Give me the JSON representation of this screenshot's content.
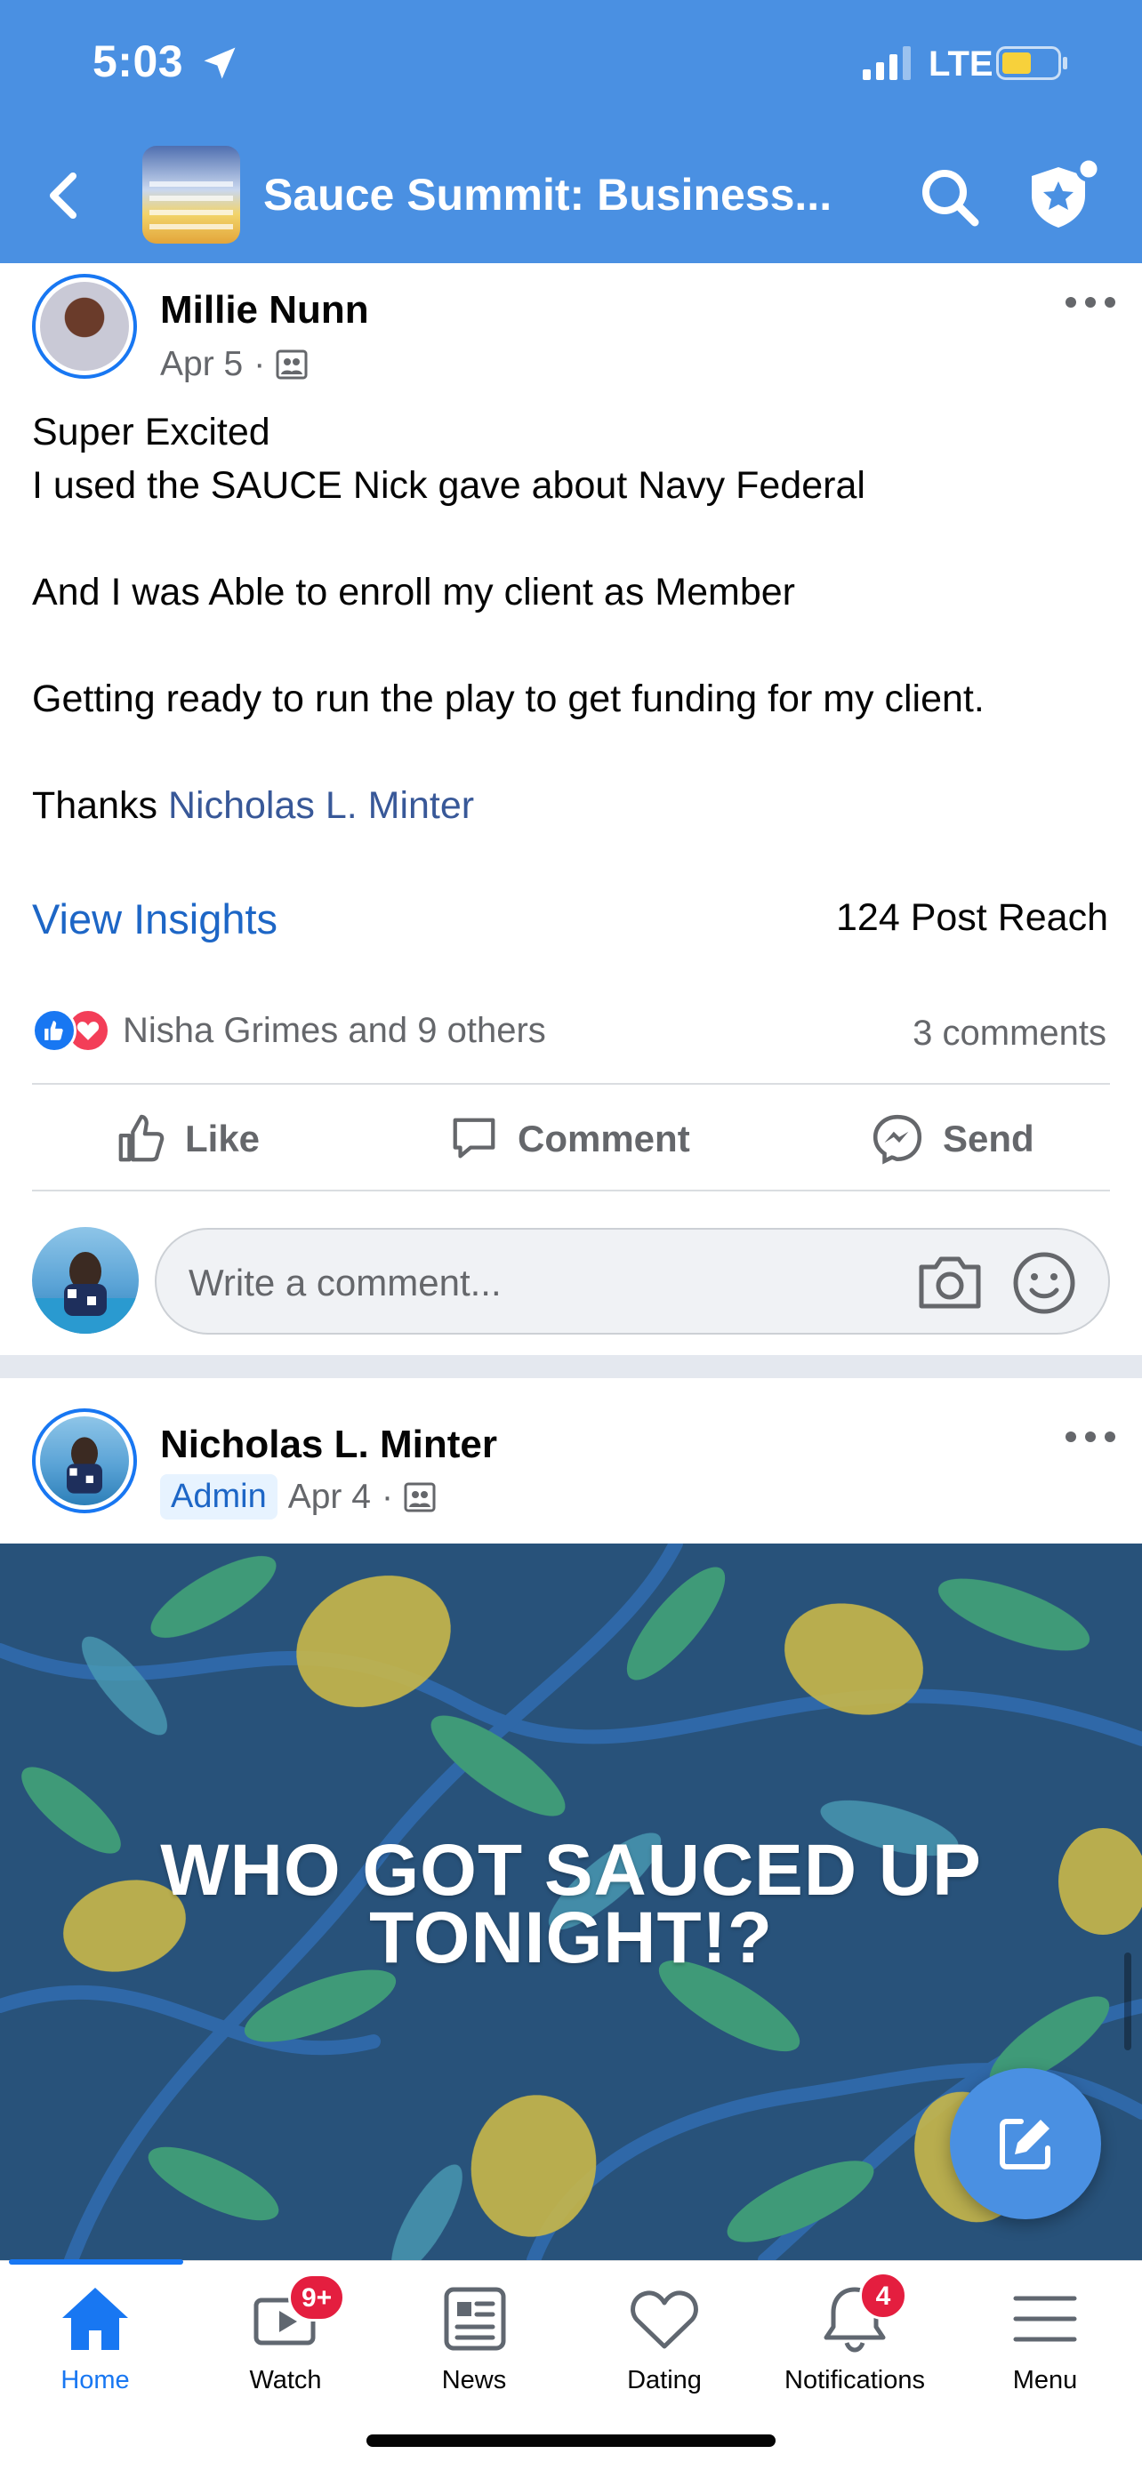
{
  "status_bar": {
    "time": "5:03",
    "network": "LTE"
  },
  "header": {
    "group_name": "Sauce Summit: Business..."
  },
  "post1": {
    "author": "Millie Nunn",
    "date": "Apr 5",
    "separator": "·",
    "lines": {
      "l1": "Super Excited",
      "l2": "I used the SAUCE Nick gave about Navy Federal",
      "l3": "And I was Able to enroll my client as Member",
      "l4": "Getting ready to run the play to get funding for my client.",
      "thanks_prefix": "Thanks ",
      "mention": "Nicholas L. Minter"
    },
    "insights_label": "View Insights",
    "reach": "124 Post Reach",
    "reactions_text": "Nisha Grimes and 9 others",
    "comments": "3 comments",
    "actions": {
      "like": "Like",
      "comment": "Comment",
      "send": "Send"
    },
    "comment_placeholder": "Write a comment..."
  },
  "post2": {
    "author": "Nicholas L. Minter",
    "role": "Admin",
    "date": "Apr 4",
    "separator": "·",
    "banner_line1": "WHO GOT SAUCED UP",
    "banner_line2": "TONIGHT!?"
  },
  "tabbar": {
    "home": "Home",
    "watch": "Watch",
    "watch_badge": "9+",
    "news": "News",
    "dating": "Dating",
    "notifications": "Notifications",
    "notifications_badge": "4",
    "menu": "Menu"
  },
  "colors": {
    "header_bg": "#4a90e2",
    "accent": "#1877f2",
    "link": "#385898",
    "badge": "#e41e3f",
    "banner_bg": "#28527a"
  }
}
